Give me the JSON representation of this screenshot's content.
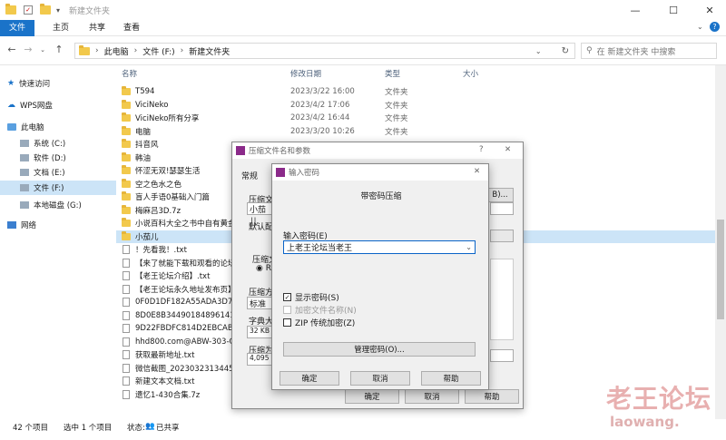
{
  "window": {
    "title": "新建文件夹",
    "minimize": "—",
    "maximize": "☐",
    "close": "✕"
  },
  "ribbon": {
    "tabs": [
      "文件",
      "主页",
      "共享",
      "查看"
    ]
  },
  "address": {
    "crumbs": [
      "此电脑",
      "文件 (F:)",
      "新建文件夹"
    ],
    "search_placeholder": "在 新建文件夹 中搜索"
  },
  "sidebar": {
    "items": [
      "快速访问",
      "WPS网盘",
      "此电脑",
      "系统 (C:)",
      "软件 (D:)",
      "文档 (E:)",
      "文件 (F:)",
      "本地磁盘 (G:)",
      "网络"
    ]
  },
  "columns": {
    "name": "名称",
    "date": "修改日期",
    "type": "类型",
    "size": "大小"
  },
  "files": [
    {
      "name": "T594",
      "date": "2023/3/22 16:00",
      "type": "文件夹"
    },
    {
      "name": "ViciNeko",
      "date": "2023/4/2 17:06",
      "type": "文件夹"
    },
    {
      "name": "ViciNeko所有分享",
      "date": "2023/4/2 16:44",
      "type": "文件夹"
    },
    {
      "name": "电脑",
      "date": "2023/3/20 10:26",
      "type": "文件夹"
    },
    {
      "name": "抖音风",
      "date": "",
      "type": ""
    },
    {
      "name": "韩油",
      "date": "",
      "type": ""
    },
    {
      "name": "怀涩无双!瑟瑟生活",
      "date": "",
      "type": ""
    },
    {
      "name": "空之色水之色",
      "date": "",
      "type": ""
    },
    {
      "name": "盲人手语0基础入门篇",
      "date": "",
      "type": ""
    },
    {
      "name": "梅麻吕3D.7z",
      "date": "",
      "type": ""
    },
    {
      "name": "小说百科大全之书中自有黄金",
      "date": "",
      "type": ""
    },
    {
      "name": "小茄儿",
      "date": "",
      "type": ""
    },
    {
      "name": "！先看我！.txt",
      "date": "",
      "type": ""
    },
    {
      "name": "【来了就能下载和观看的论坛",
      "date": "",
      "type": ""
    },
    {
      "name": "【老王论坛介绍】.txt",
      "date": "",
      "type": ""
    },
    {
      "name": "【老王论坛永久地址发布页】",
      "date": "",
      "type": ""
    },
    {
      "name": "0F0D1DF182A55ADA3D7C",
      "date": "",
      "type": ""
    },
    {
      "name": "8D0E8B344901848961410",
      "date": "",
      "type": ""
    },
    {
      "name": "9D22FBDFC814D2EBCAB5",
      "date": "",
      "type": ""
    },
    {
      "name": "hhd800.com@ABW-303-C",
      "date": "",
      "type": ""
    },
    {
      "name": "获取最新地址.txt",
      "date": "",
      "type": ""
    },
    {
      "name": "微信截图_20230323134450",
      "date": "",
      "type": ""
    },
    {
      "name": "新建文本文档.txt",
      "date": "",
      "type": ""
    },
    {
      "name": "遗忆1-430合集.7z",
      "date": "",
      "type": ""
    }
  ],
  "status": {
    "count": "42 个项目",
    "selected": "选中 1 个项目",
    "state": "状态:",
    "shared": "已共享"
  },
  "archive_dialog": {
    "title": "压缩文件名和参数",
    "help": "?",
    "close": "✕",
    "tab_general": "常规",
    "label_name": "压缩文",
    "name_value": "小茄儿",
    "label_profile": "默认配",
    "label_format": "压缩文",
    "format_rar": "RA",
    "label_method": "压缩方",
    "method_value": "标准",
    "label_dict": "字典大",
    "dict_value": "32 KB",
    "label_split": "压缩为",
    "split_value": "4,095",
    "browse": "B)...",
    "ok": "确定",
    "cancel": "取消",
    "help_btn": "帮助"
  },
  "password_dialog": {
    "title": "输入密码",
    "close": "✕",
    "heading": "带密码压缩",
    "label": "输入密码(E)",
    "value": "上老王论坛当老王",
    "show_pwd": "显示密码(S)",
    "encrypt_names": "加密文件名称(N)",
    "zip_legacy": "ZIP 传统加密(Z)",
    "manage": "管理密码(O)...",
    "ok": "确定",
    "cancel": "取消",
    "help": "帮助"
  },
  "watermark": {
    "cn": "老王论坛",
    "en": "laowang."
  }
}
